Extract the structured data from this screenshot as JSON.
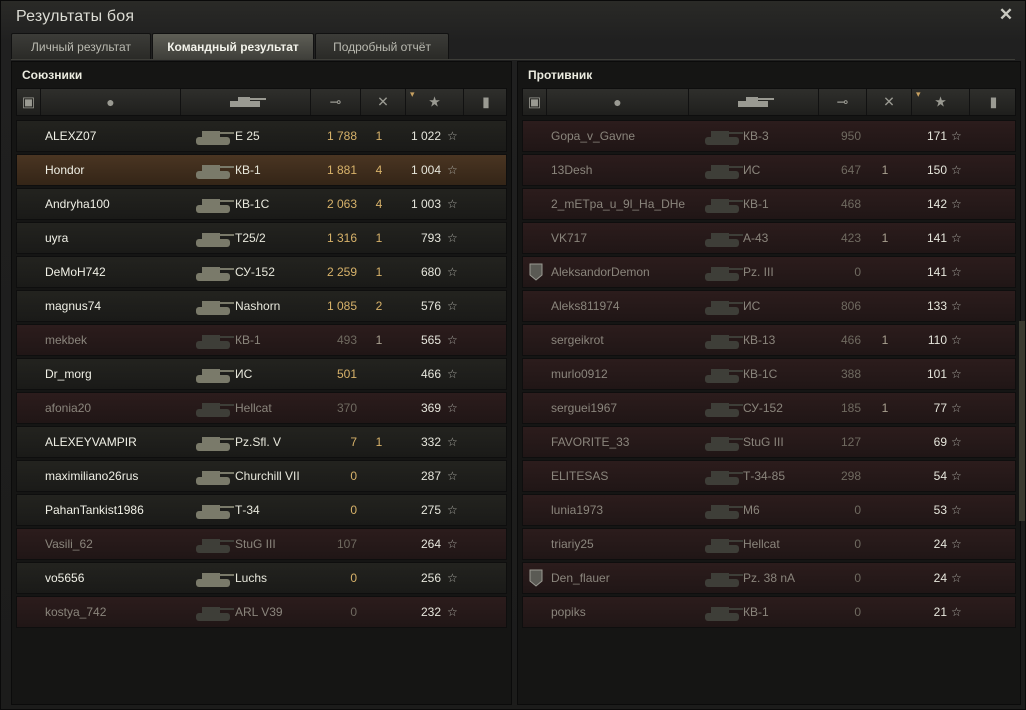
{
  "window": {
    "title": "Результаты боя"
  },
  "tabs": [
    {
      "label": "Личный результат",
      "active": false
    },
    {
      "label": "Командный результат",
      "active": true
    },
    {
      "label": "Подробный отчёт",
      "active": false
    }
  ],
  "allies": {
    "title": "Союзники",
    "rows": [
      {
        "name": "ALEXZ07",
        "vehicle": "E 25",
        "damage": "1 788",
        "frags": "1",
        "xp": "1 022",
        "state": "alive"
      },
      {
        "name": "Hondor",
        "vehicle": "КВ-1",
        "damage": "1 881",
        "frags": "4",
        "xp": "1 004",
        "state": "highlight"
      },
      {
        "name": "Andryha100",
        "vehicle": "КВ-1С",
        "damage": "2 063",
        "frags": "4",
        "xp": "1 003",
        "state": "alive"
      },
      {
        "name": "uyra",
        "vehicle": "T25/2",
        "damage": "1 316",
        "frags": "1",
        "xp": "793",
        "state": "alive"
      },
      {
        "name": "DeMoH742",
        "vehicle": "СУ-152",
        "damage": "2 259",
        "frags": "1",
        "xp": "680",
        "state": "alive"
      },
      {
        "name": "magnus74",
        "vehicle": "Nashorn",
        "damage": "1 085",
        "frags": "2",
        "xp": "576",
        "state": "alive"
      },
      {
        "name": "mekbek",
        "vehicle": "КВ-1",
        "damage": "493",
        "frags": "1",
        "xp": "565",
        "state": "dead"
      },
      {
        "name": "Dr_morg",
        "vehicle": "ИС",
        "damage": "501",
        "frags": "",
        "xp": "466",
        "state": "alive"
      },
      {
        "name": "afonia20",
        "vehicle": "Hellcat",
        "damage": "370",
        "frags": "",
        "xp": "369",
        "state": "dead"
      },
      {
        "name": "ALEXEYVAMPIR",
        "vehicle": "Pz.Sfl. V",
        "damage": "7",
        "frags": "1",
        "xp": "332",
        "state": "alive"
      },
      {
        "name": "maximiliano26rus",
        "vehicle": "Churchill VII",
        "damage": "0",
        "frags": "",
        "xp": "287",
        "state": "alive"
      },
      {
        "name": "PahanTankist1986",
        "vehicle": "Т-34",
        "damage": "0",
        "frags": "",
        "xp": "275",
        "state": "alive"
      },
      {
        "name": "Vasili_62",
        "vehicle": "StuG III",
        "damage": "107",
        "frags": "",
        "xp": "264",
        "state": "dead"
      },
      {
        "name": "vo5656",
        "vehicle": "Luchs",
        "damage": "0",
        "frags": "",
        "xp": "256",
        "state": "alive"
      },
      {
        "name": "kostya_742",
        "vehicle": "ARL V39",
        "damage": "0",
        "frags": "",
        "xp": "232",
        "state": "dead"
      }
    ]
  },
  "enemies": {
    "title": "Противник",
    "rows": [
      {
        "name": "Gopa_v_Gavne",
        "vehicle": "КВ-3",
        "damage": "950",
        "frags": "",
        "xp": "171",
        "state": "dead",
        "badge": false
      },
      {
        "name": "13Desh",
        "vehicle": "ИС",
        "damage": "647",
        "frags": "1",
        "xp": "150",
        "state": "dead",
        "badge": false
      },
      {
        "name": "2_mETpa_u_9l_Ha_DHe",
        "vehicle": "КВ-1",
        "damage": "468",
        "frags": "",
        "xp": "142",
        "state": "dead",
        "badge": false
      },
      {
        "name": "VK717",
        "vehicle": "А-43",
        "damage": "423",
        "frags": "1",
        "xp": "141",
        "state": "dead",
        "badge": false
      },
      {
        "name": "AleksandorDemon",
        "vehicle": "Pz. III",
        "damage": "0",
        "frags": "",
        "xp": "141",
        "state": "dead",
        "badge": true
      },
      {
        "name": "Aleks811974",
        "vehicle": "ИС",
        "damage": "806",
        "frags": "",
        "xp": "133",
        "state": "dead",
        "badge": false
      },
      {
        "name": "sergeikrot",
        "vehicle": "КВ-13",
        "damage": "466",
        "frags": "1",
        "xp": "110",
        "state": "dead",
        "badge": false
      },
      {
        "name": "murlo0912",
        "vehicle": "КВ-1С",
        "damage": "388",
        "frags": "",
        "xp": "101",
        "state": "dead",
        "badge": false
      },
      {
        "name": "serguei1967",
        "vehicle": "СУ-152",
        "damage": "185",
        "frags": "1",
        "xp": "77",
        "state": "dead",
        "badge": false
      },
      {
        "name": "FAVORITE_33",
        "vehicle": "StuG III",
        "damage": "127",
        "frags": "",
        "xp": "69",
        "state": "dead",
        "badge": false
      },
      {
        "name": "ELITESAS",
        "vehicle": "Т-34-85",
        "damage": "298",
        "frags": "",
        "xp": "54",
        "state": "dead",
        "badge": false
      },
      {
        "name": "lunia1973",
        "vehicle": "M6",
        "damage": "0",
        "frags": "",
        "xp": "53",
        "state": "dead",
        "badge": false
      },
      {
        "name": "triariy25",
        "vehicle": "Hellcat",
        "damage": "0",
        "frags": "",
        "xp": "24",
        "state": "dead",
        "badge": false
      },
      {
        "name": "Den_flauer",
        "vehicle": "Pz. 38 nA",
        "damage": "0",
        "frags": "",
        "xp": "24",
        "state": "dead",
        "badge": true
      },
      {
        "name": "popiks",
        "vehicle": "КВ-1",
        "damage": "0",
        "frags": "",
        "xp": "21",
        "state": "dead",
        "badge": false
      }
    ]
  },
  "columns": [
    "rank-icon",
    "player-icon",
    "tank-icon",
    "damage-icon",
    "frags-icon",
    "xp-star-icon",
    "medal-icon"
  ],
  "colors": {
    "accent": "#d7b26a",
    "dead_row": "#2c1c1c",
    "highlight_row": "#4a3522"
  }
}
